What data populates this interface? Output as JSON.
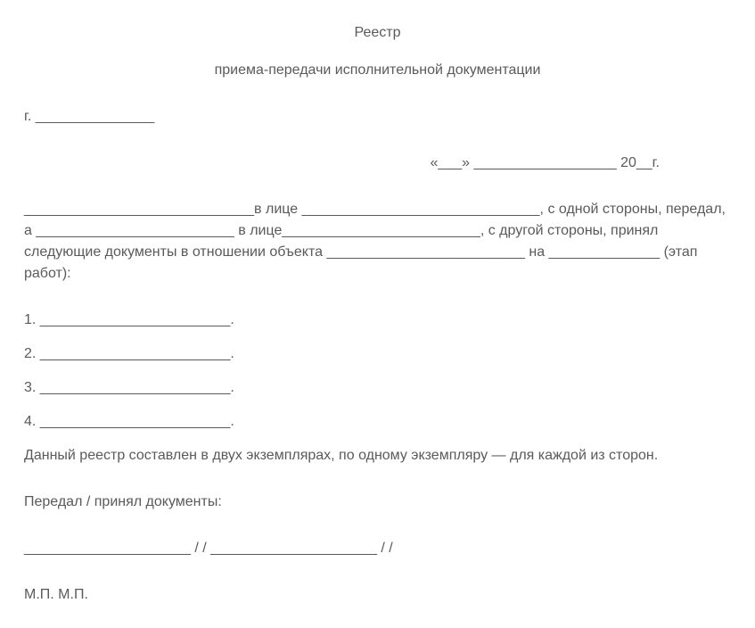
{
  "title": "Реестр",
  "subtitle": "приема-передачи исполнительной документации",
  "city_line": "г. _______________",
  "date_line": "«___» __________________ 20__г.",
  "main_paragraph": "_____________________________в лице ______________________________, с одной стороны, передал, а _________________________ в лице_________________________, с другой стороны, принял следующие документы в отношении объекта _________________________ на ______________ (этап работ):",
  "list": {
    "item1": "1. ________________________.",
    "item2": "2. ________________________.",
    "item3": "3. ________________________.",
    "item4": "4. ________________________."
  },
  "copies_paragraph": "Данный реестр составлен в двух экземплярах, по одному экземпляру — для каждой из сторон.",
  "transfer_line": "Передал / принял документы:",
  "signature_line": "_____________________ / / _____________________ / /",
  "seal_line": "М.П. М.П."
}
